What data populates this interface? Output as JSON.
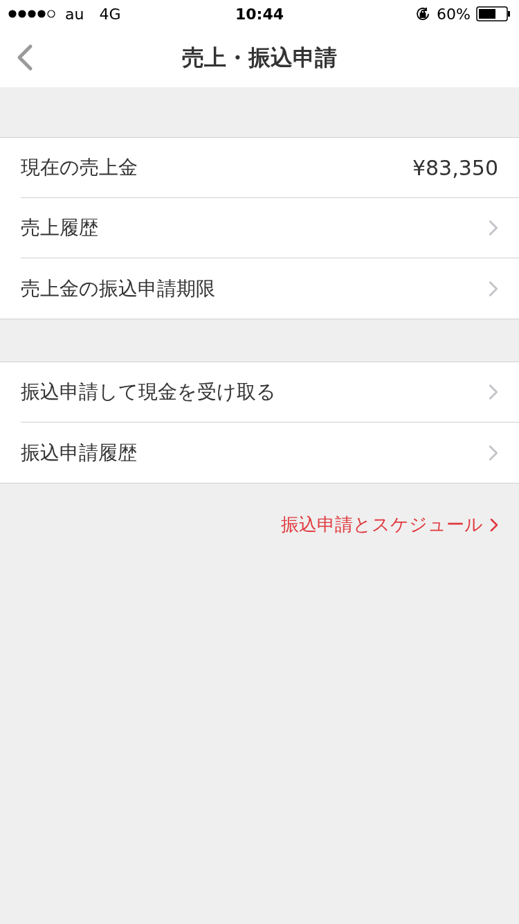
{
  "status_bar": {
    "carrier": "au",
    "network": "4G",
    "time": "10:44",
    "battery_text": "60%"
  },
  "nav": {
    "title": "売上・振込申請"
  },
  "sections": [
    {
      "rows": [
        {
          "kind": "value",
          "label": "現在の売上金",
          "value": "¥83,350"
        },
        {
          "kind": "link",
          "label": "売上履歴"
        },
        {
          "kind": "link",
          "label": "売上金の振込申請期限"
        }
      ]
    },
    {
      "rows": [
        {
          "kind": "link",
          "label": "振込申請して現金を受け取る"
        },
        {
          "kind": "link",
          "label": "振込申請履歴"
        }
      ]
    }
  ],
  "footer_link": {
    "label": "振込申請とスケジュール"
  }
}
